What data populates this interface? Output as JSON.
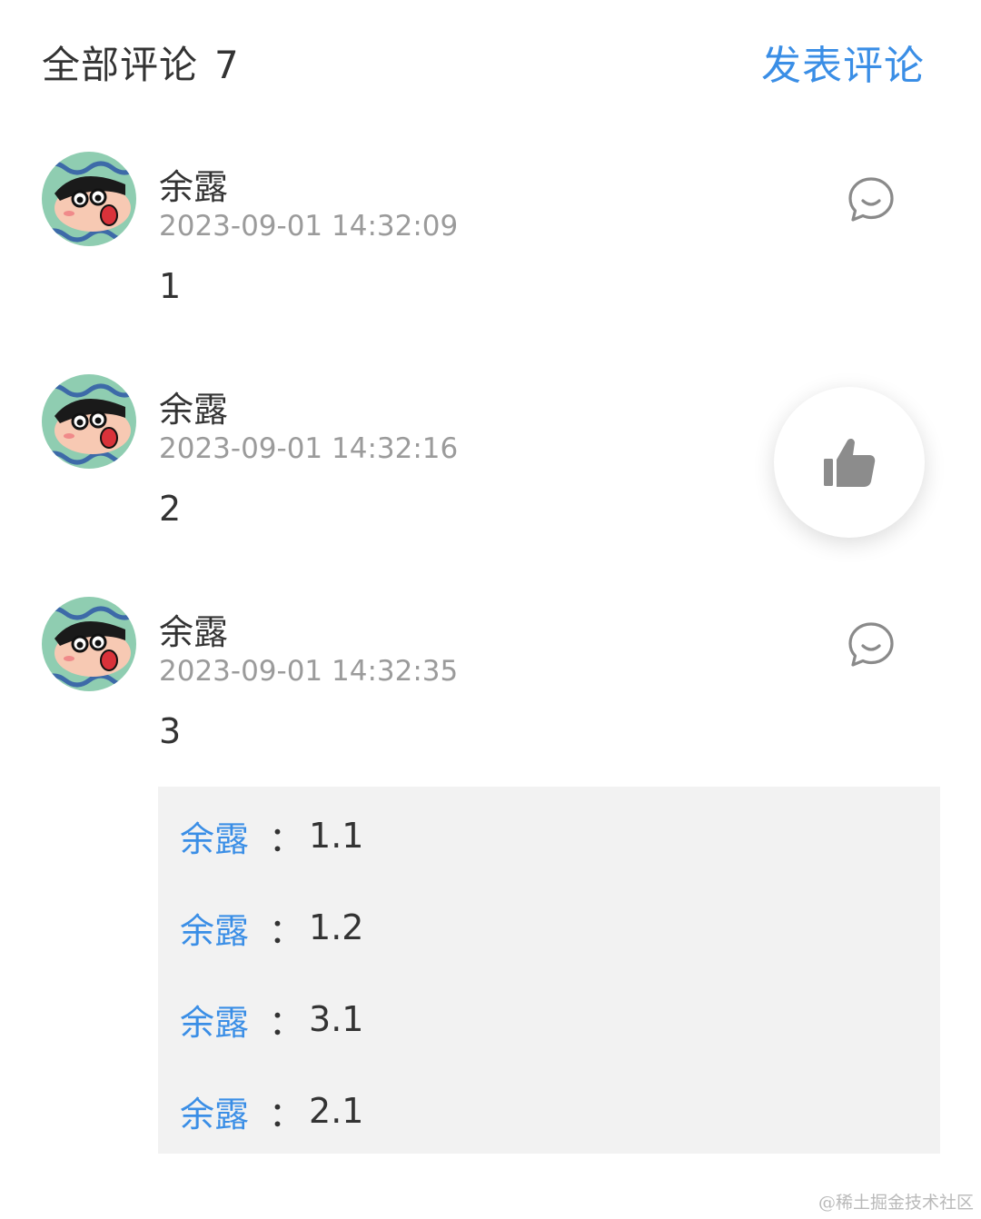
{
  "header": {
    "title": "全部评论",
    "count": "7",
    "post_label": "发表评论"
  },
  "comments": [
    {
      "author": "余露",
      "time": "2023-09-01 14:32:09",
      "content": "1"
    },
    {
      "author": "余露",
      "time": "2023-09-01 14:32:16",
      "content": "2"
    },
    {
      "author": "余露",
      "time": "2023-09-01 14:32:35",
      "content": "3"
    }
  ],
  "replies": [
    {
      "name": "余露",
      "sep": "：",
      "text": "1.1"
    },
    {
      "name": "余露",
      "sep": "：",
      "text": "1.2"
    },
    {
      "name": "余露",
      "sep": "：",
      "text": "3.1"
    },
    {
      "name": "余露",
      "sep": "：",
      "text": "2.1"
    }
  ],
  "watermark": "@稀土掘金技术社区",
  "icons": {
    "reply": "comment-bubble-icon",
    "like": "thumbs-up-icon",
    "avatar": "cartoon-avatar"
  },
  "colors": {
    "accent": "#3a8ee6",
    "text": "#333333",
    "muted": "#9b9b9b",
    "reply_bg": "#f2f2f2"
  }
}
